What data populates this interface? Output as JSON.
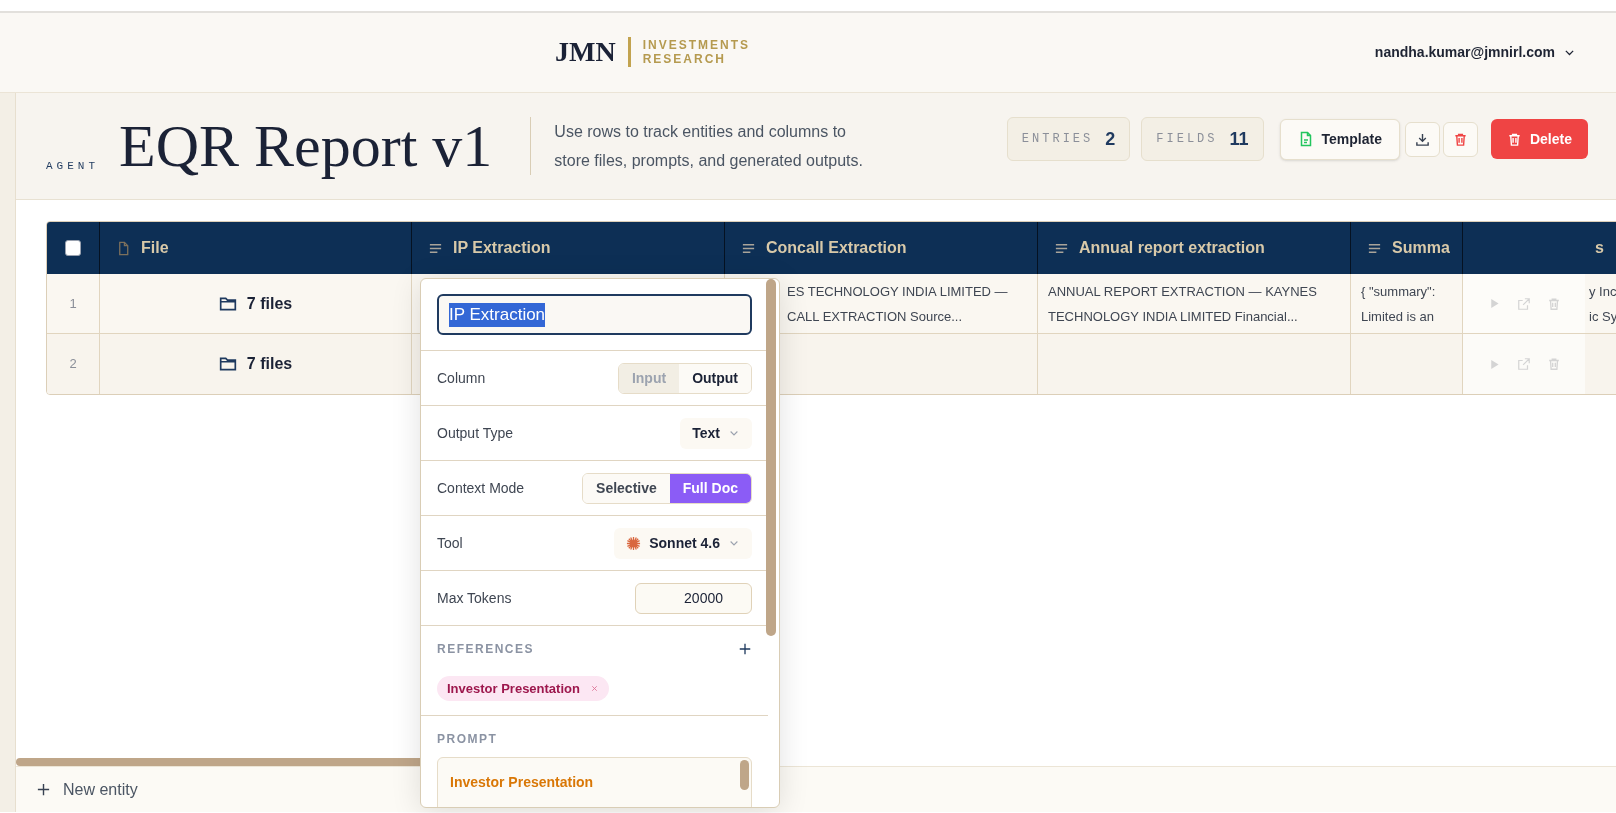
{
  "header": {
    "logo": {
      "mark": "JMN",
      "line1": "INVESTMENTS",
      "line2": "RESEARCH"
    },
    "user": "nandha.kumar@jmnirl.com"
  },
  "agent": {
    "label": "AGENT",
    "title": "EQR Report v1",
    "description": "Use rows to track entities and columns to store files, prompts, and generated outputs.",
    "stats": [
      {
        "label": "ENTRIES",
        "value": "2"
      },
      {
        "label": "FIELDS",
        "value": "11"
      }
    ],
    "template_button": "Template",
    "delete_button": "Delete"
  },
  "table": {
    "all_selected": false,
    "columns": [
      {
        "kind": "file",
        "label": "File"
      },
      {
        "kind": "text",
        "label": "IP Extraction"
      },
      {
        "kind": "text",
        "label": "Concall Extraction"
      },
      {
        "kind": "text",
        "label": "Annual report extraction"
      },
      {
        "kind": "text",
        "label": "Summa"
      },
      {
        "kind": "actions"
      },
      {
        "kind": "partial",
        "label": "s"
      }
    ],
    "rows": [
      {
        "index": "1",
        "cells": [
          "7 files",
          "",
          "ES TECHNOLOGY INDIA LIMITED —\nCALL EXTRACTION Source...",
          "ANNUAL REPORT EXTRACTION — KAYNES\nTECHNOLOGY INDIA LIMITED Financial...",
          "{ \"summary\":\nLimited is an",
          "",
          "y Inc\nic Sy"
        ]
      },
      {
        "index": "2",
        "cells": [
          "7 files",
          "",
          "",
          "",
          "",
          "",
          ""
        ]
      }
    ]
  },
  "column_editor": {
    "name": "IP Extraction",
    "rows": [
      {
        "kind": "segmented",
        "label": "Column",
        "options": [
          {
            "label": "Input",
            "selected": false
          },
          {
            "label": "Output",
            "selected": true
          }
        ]
      },
      {
        "kind": "dropdown",
        "label": "Output Type",
        "value": "Text"
      },
      {
        "kind": "mode-switch",
        "label": "Context Mode",
        "options": [
          {
            "label": "Selective",
            "selected": false
          },
          {
            "label": "Full Doc",
            "selected": true
          }
        ]
      },
      {
        "kind": "model-dropdown",
        "label": "Tool",
        "value": "Sonnet 4.6"
      },
      {
        "kind": "number",
        "label": "Max Tokens",
        "value": "20000"
      }
    ],
    "references": {
      "heading": "REFERENCES",
      "tags": [
        "Investor Presentation"
      ]
    },
    "prompt": {
      "heading": "PROMPT",
      "title": "Investor Presentation"
    }
  },
  "footer": {
    "new_entity": "New entity"
  }
}
